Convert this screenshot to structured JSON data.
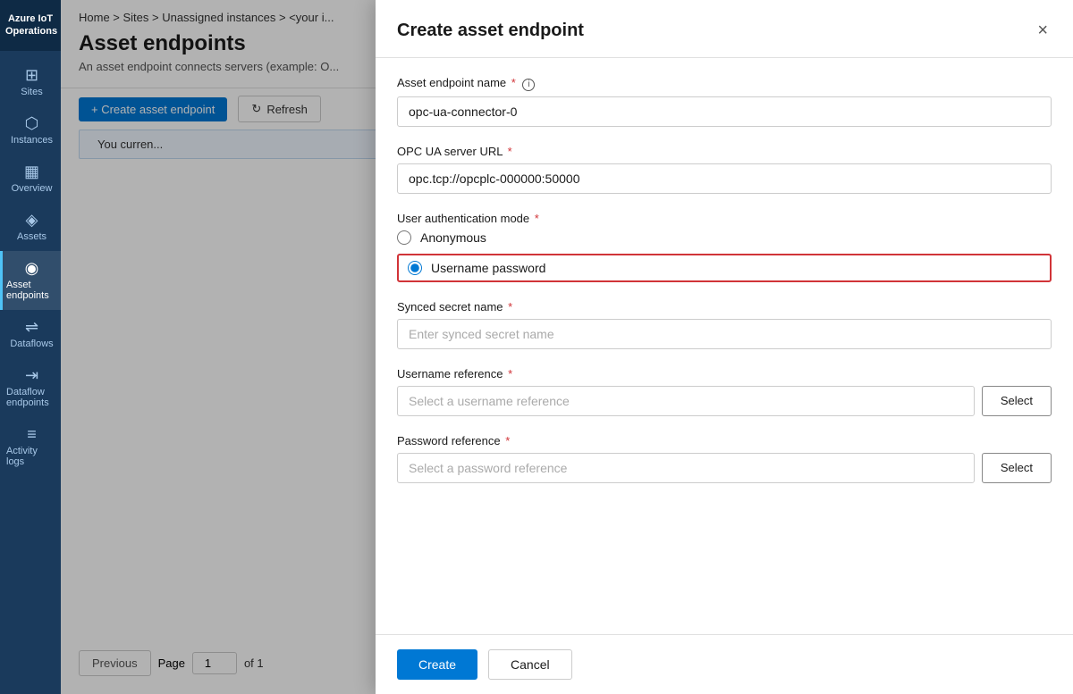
{
  "app": {
    "title": "Azure IoT Operations"
  },
  "sidebar": {
    "items": [
      {
        "id": "sites",
        "label": "Sites",
        "icon": "⊞"
      },
      {
        "id": "instances",
        "label": "Instances",
        "icon": "⬡"
      },
      {
        "id": "overview",
        "label": "Overview",
        "icon": "▦"
      },
      {
        "id": "assets",
        "label": "Assets",
        "icon": "◈"
      },
      {
        "id": "asset-endpoints",
        "label": "Asset endpoints",
        "icon": "◉",
        "active": true
      },
      {
        "id": "dataflows",
        "label": "Dataflows",
        "icon": "⇌"
      },
      {
        "id": "dataflow-endpoints",
        "label": "Dataflow endpoints",
        "icon": "⇥"
      },
      {
        "id": "activity-logs",
        "label": "Activity logs",
        "icon": "≡"
      }
    ]
  },
  "page": {
    "breadcrumb": "Home > Sites > Unassigned instances > <your i...",
    "title": "Asset endpoints",
    "subtitle": "An asset endpoint connects servers (example: O...",
    "notification": "You curren...",
    "create_button": "+ Create asset endpoint",
    "refresh_button": "Refresh"
  },
  "pagination": {
    "previous_label": "Previous",
    "page_value": "1",
    "of_label": "of 1"
  },
  "modal": {
    "title": "Create asset endpoint",
    "close_label": "×",
    "fields": {
      "endpoint_name": {
        "label": "Asset endpoint name",
        "value": "opc-ua-connector-0",
        "required": true,
        "has_info": true
      },
      "server_url": {
        "label": "OPC UA server URL",
        "value": "opc.tcp://opcplc-000000:50000",
        "required": true
      },
      "auth_mode": {
        "label": "User authentication mode",
        "required": true,
        "options": [
          {
            "id": "anonymous",
            "label": "Anonymous",
            "selected": false
          },
          {
            "id": "username-password",
            "label": "Username password",
            "selected": true
          }
        ]
      },
      "synced_secret": {
        "label": "Synced secret name",
        "placeholder": "Enter synced secret name",
        "required": true
      },
      "username_reference": {
        "label": "Username reference",
        "placeholder": "Select a username reference",
        "required": true,
        "select_button": "Select"
      },
      "password_reference": {
        "label": "Password reference",
        "placeholder": "Select a password reference",
        "required": true,
        "select_button": "Select"
      }
    },
    "footer": {
      "create_label": "Create",
      "cancel_label": "Cancel"
    }
  }
}
